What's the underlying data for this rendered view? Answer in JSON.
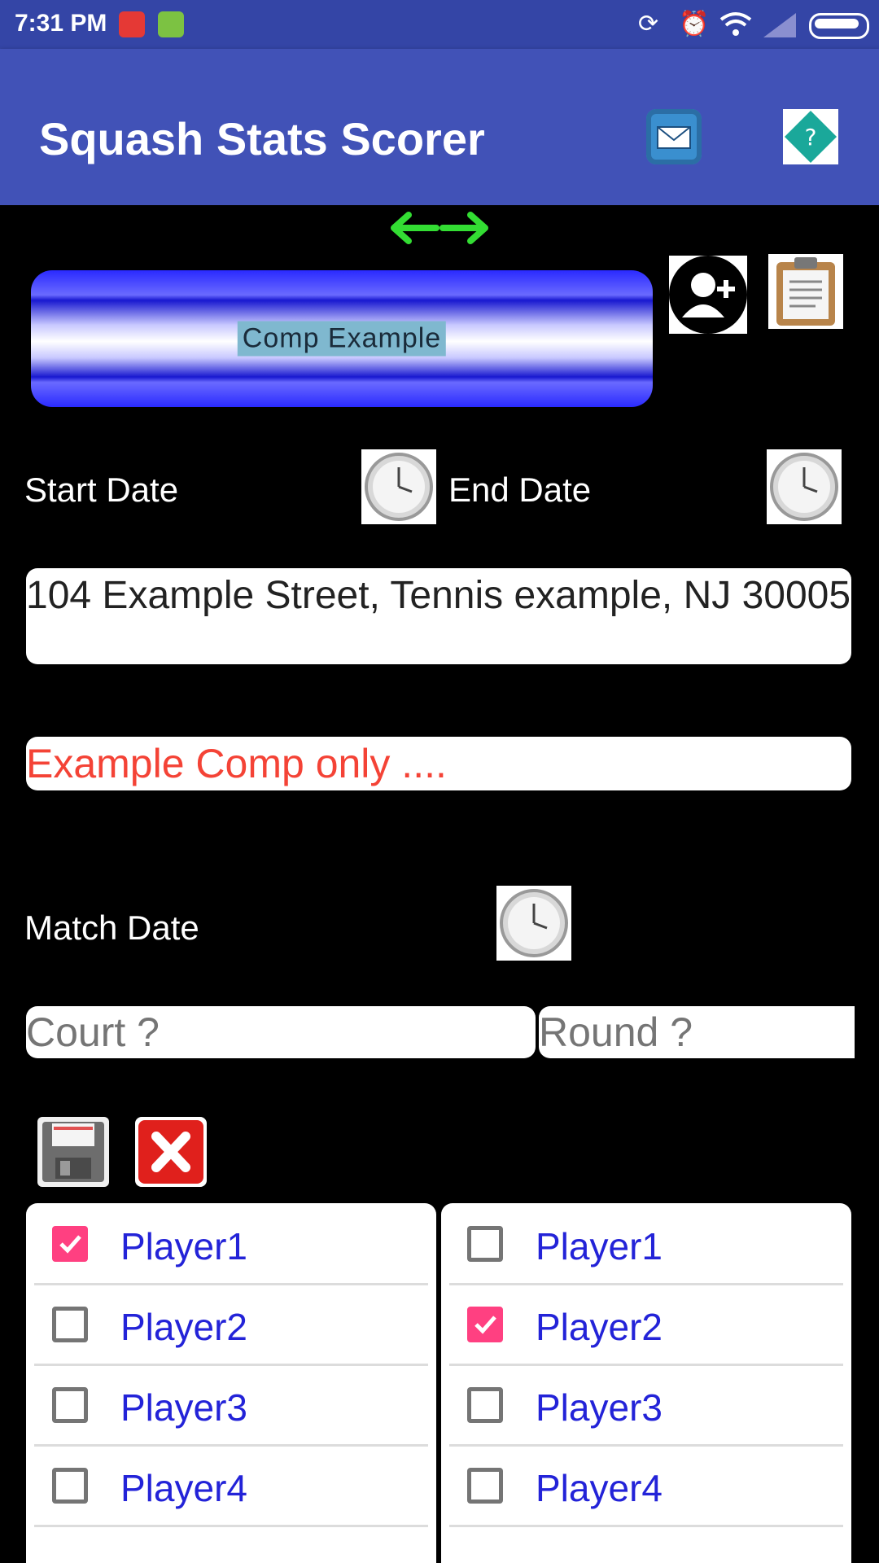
{
  "status": {
    "time": "7:31 PM"
  },
  "app": {
    "title": "Squash Stats Scorer"
  },
  "competition": {
    "name": "Comp Example",
    "start_date_label": "Start Date",
    "end_date_label": "End Date",
    "address": "104 Example Street, Tennis example, NJ 30005",
    "note": "Example Comp only ....",
    "match_date_label": "Match Date",
    "court_placeholder": "Court ?",
    "round_placeholder": "Round ?"
  },
  "players_left": [
    {
      "name": "Player1",
      "checked": true
    },
    {
      "name": "Player2",
      "checked": false
    },
    {
      "name": "Player3",
      "checked": false
    },
    {
      "name": "Player4",
      "checked": false
    }
  ],
  "players_right": [
    {
      "name": "Player1",
      "checked": false
    },
    {
      "name": "Player2",
      "checked": true
    },
    {
      "name": "Player3",
      "checked": false
    },
    {
      "name": "Player4",
      "checked": false
    }
  ],
  "colors": {
    "app_bar": "#4152b7",
    "status_bar": "#3445a6",
    "accent": "#ff4081",
    "player_text": "#2323d8",
    "note_text": "#f44336"
  }
}
